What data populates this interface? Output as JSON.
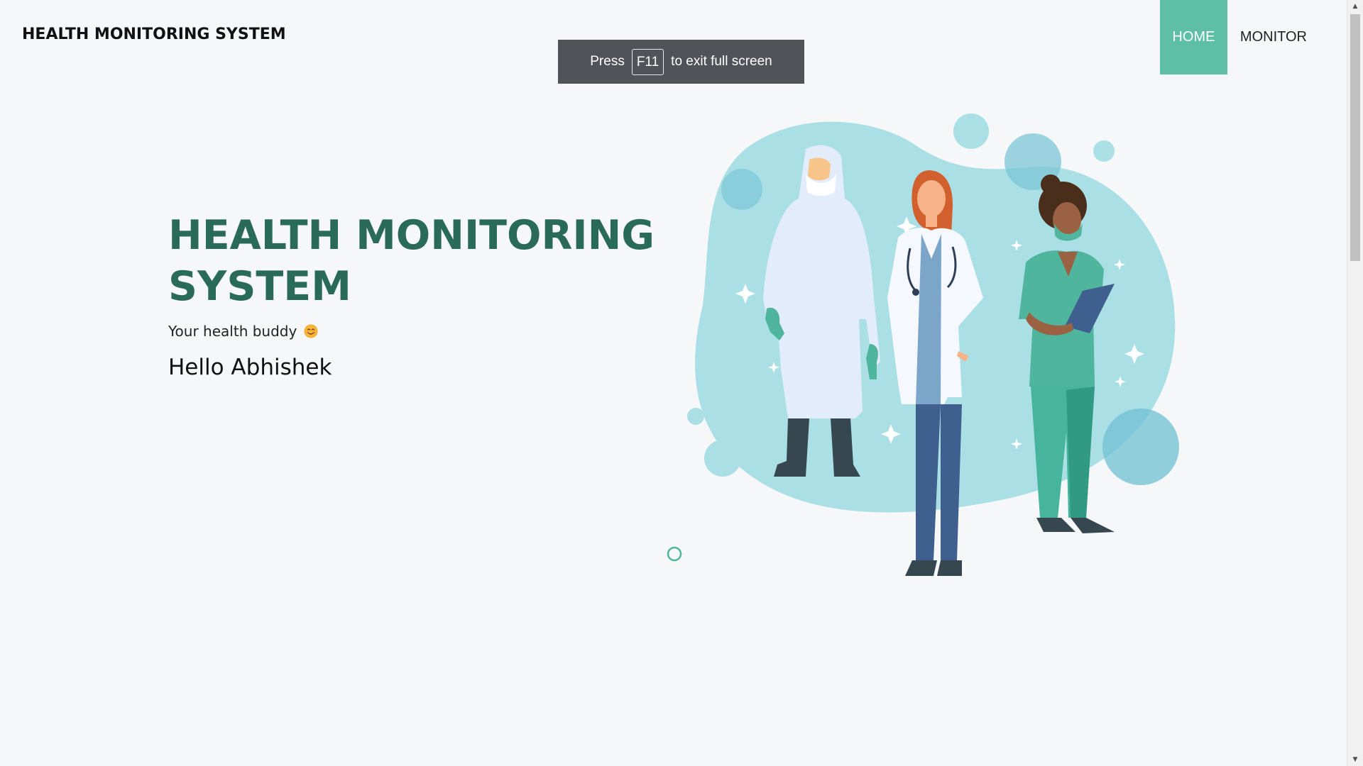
{
  "header": {
    "brand": "HEALTH MONITORING SYSTEM",
    "nav": [
      {
        "label": "HOME",
        "active": true
      },
      {
        "label": "MONITOR",
        "active": false
      }
    ]
  },
  "fullscreen_notice": {
    "prefix": "Press",
    "key": "F11",
    "suffix": "to exit full screen"
  },
  "hero": {
    "title": "HEALTH MONITORING SYSTEM",
    "subtitle": "Your health buddy",
    "subtitle_icon": "smiling-face-emoji",
    "greeting": "Hello Abhishek"
  },
  "illustration": {
    "icon": "medical-staff-illustration"
  },
  "colors": {
    "accent": "#5ebea6",
    "title": "#2a6b58",
    "background": "#f5f7f9",
    "blob": "#aadfe6"
  }
}
